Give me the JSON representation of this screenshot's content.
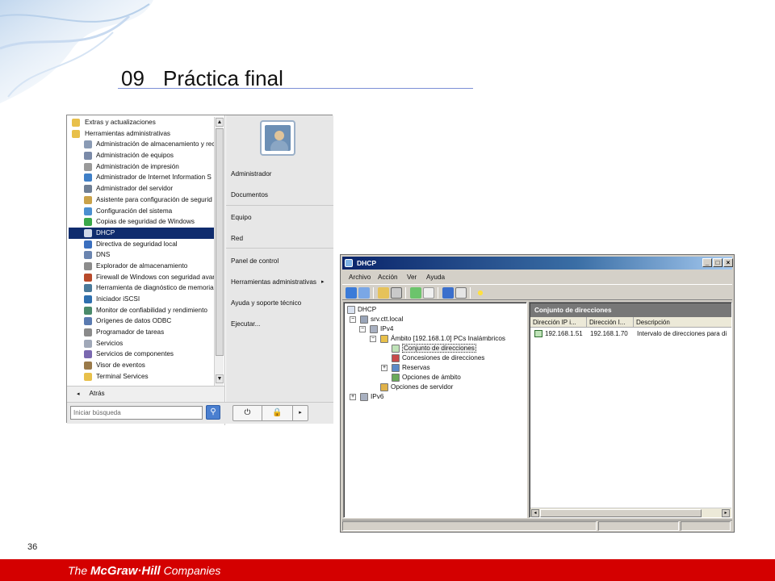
{
  "slide": {
    "section_number": "09",
    "section_title": "Práctica final",
    "page_number": "36",
    "footer_brand_prefix": "The ",
    "footer_brand_name": "McGraw·Hill",
    "footer_brand_suffix": " Companies"
  },
  "start_menu": {
    "programs": [
      {
        "label": "Extras y actualizaciones",
        "icon": "folder-icon",
        "top": true
      },
      {
        "label": "Herramientas administrativas",
        "icon": "folder-icon",
        "top": true
      },
      {
        "label": "Administración de almacenamiento y rec",
        "icon": "storage-admin-icon"
      },
      {
        "label": "Administración de equipos",
        "icon": "computer-management-icon"
      },
      {
        "label": "Administración de impresión",
        "icon": "print-management-icon"
      },
      {
        "label": "Administrador de Internet Information S",
        "icon": "iis-manager-icon"
      },
      {
        "label": "Administrador del servidor",
        "icon": "server-manager-icon"
      },
      {
        "label": "Asistente para configuración de segurid",
        "icon": "security-wizard-icon"
      },
      {
        "label": "Configuración del sistema",
        "icon": "system-config-icon"
      },
      {
        "label": "Copias de seguridad de Windows",
        "icon": "backup-icon"
      },
      {
        "label": "DHCP",
        "icon": "dhcp-icon",
        "selected": true
      },
      {
        "label": "Directiva de seguridad local",
        "icon": "security-policy-icon"
      },
      {
        "label": "DNS",
        "icon": "dns-icon"
      },
      {
        "label": "Explorador de almacenamiento",
        "icon": "storage-explorer-icon"
      },
      {
        "label": "Firewall de Windows con seguridad avar",
        "icon": "firewall-icon"
      },
      {
        "label": "Herramienta de diagnóstico de memoria",
        "icon": "memory-diagnostic-icon"
      },
      {
        "label": "Iniciador iSCSI",
        "icon": "iscsi-icon"
      },
      {
        "label": "Monitor de confiabilidad y rendimiento",
        "icon": "performance-monitor-icon"
      },
      {
        "label": "Orígenes de datos ODBC",
        "icon": "odbc-icon"
      },
      {
        "label": "Programador de tareas",
        "icon": "task-scheduler-icon"
      },
      {
        "label": "Servicios",
        "icon": "services-icon"
      },
      {
        "label": "Servicios de componentes",
        "icon": "component-services-icon"
      },
      {
        "label": "Visor de eventos",
        "icon": "event-viewer-icon"
      },
      {
        "label": "Terminal Services",
        "icon": "folder-icon"
      }
    ],
    "back_label": "Atrás",
    "search_placeholder": "Iniciar búsqueda",
    "right_items": [
      {
        "label": "Administrador"
      },
      {
        "label": "Documentos"
      },
      {
        "label": "Equipo"
      },
      {
        "label": "Red"
      },
      {
        "label": "Panel de control"
      },
      {
        "label": "Herramientas administrativas",
        "submenu": "▸"
      },
      {
        "label": "Ayuda y soporte técnico"
      },
      {
        "label": "Ejecutar..."
      }
    ],
    "scroll_up": "▲",
    "scroll_down": "▼",
    "back_arrow": "◂",
    "power_glyph": "⏻",
    "lock_glyph": "🔒",
    "more_glyph": "▸",
    "search_glyph": "⚲"
  },
  "dhcp_window": {
    "title": "DHCP",
    "controls": {
      "minimize": "_",
      "maximize": "□",
      "close": "×"
    },
    "menu": [
      "Archivo",
      "Acción",
      "Ver",
      "Ayuda"
    ],
    "tree": [
      {
        "label": "DHCP",
        "icon": "dhcp-root-icon"
      },
      {
        "label": "srv.ctt.local",
        "icon": "server-icon",
        "expander": "−"
      },
      {
        "label": "IPv4",
        "icon": "ipv4-icon",
        "expander": "−"
      },
      {
        "label": "Ámbito [192.168.1.0] PCs Inalámbricos",
        "icon": "scope-folder-icon",
        "expander": "−"
      },
      {
        "label": "Conjunto de direcciones",
        "icon": "address-pool-icon",
        "highlighted": true
      },
      {
        "label": "Concesiones de direcciones",
        "icon": "leases-icon"
      },
      {
        "label": "Reservas",
        "icon": "reservations-icon",
        "expander": "+"
      },
      {
        "label": "Opciones de ámbito",
        "icon": "scope-options-icon"
      },
      {
        "label": "Opciones de servidor",
        "icon": "server-options-icon"
      },
      {
        "label": "IPv6",
        "icon": "ipv6-icon",
        "expander": "+"
      }
    ],
    "details": {
      "header": "Conjunto de direcciones",
      "columns": [
        "Dirección IP i...",
        "Dirección I...",
        "Descripción"
      ],
      "rows": [
        {
          "start": "192.168.1.51",
          "end": "192.168.1.70",
          "description": "Intervalo de direcciones para di"
        }
      ]
    },
    "scroll_left": "◂",
    "scroll_right": "▸"
  }
}
